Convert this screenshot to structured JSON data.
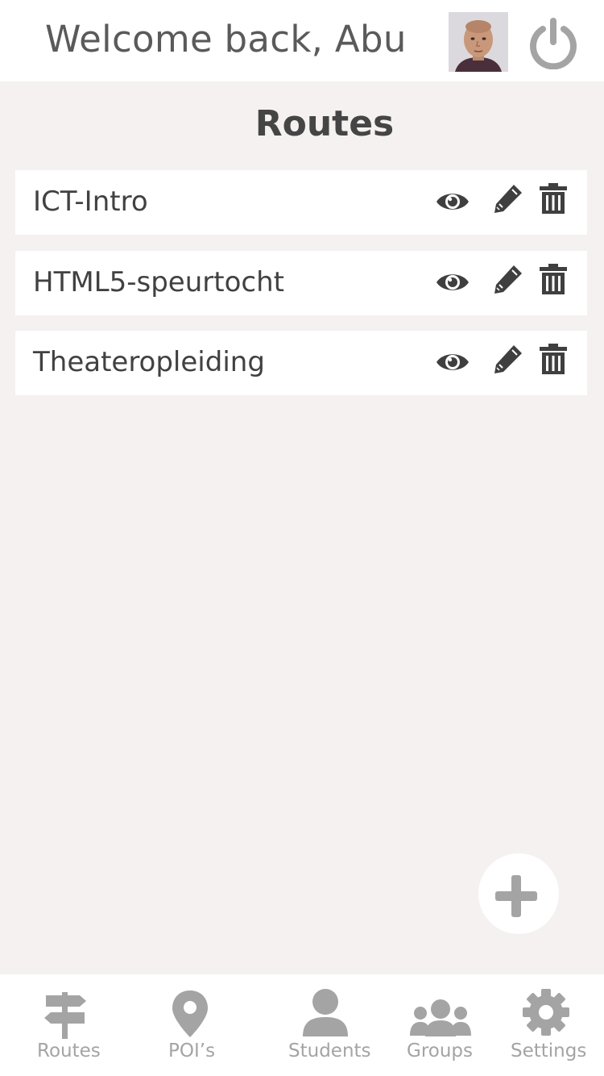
{
  "header": {
    "welcome_text": "Welcome back, Abu",
    "avatar_icon": "user-photo",
    "power_icon": "power-icon"
  },
  "main": {
    "title": "Routes",
    "routes": [
      {
        "name": "ICT-Intro"
      },
      {
        "name": "HTML5-speurtocht"
      },
      {
        "name": "Theateropleiding"
      }
    ],
    "row_actions": [
      "eye-icon",
      "pencil-icon",
      "trash-icon"
    ],
    "add_icon": "plus-icon"
  },
  "bottom_nav": {
    "items": [
      {
        "label": "Routes",
        "icon": "signpost-icon"
      },
      {
        "label": "POI’s",
        "icon": "map-pin-icon"
      },
      {
        "label": "Students",
        "icon": "person-icon"
      },
      {
        "label": "Groups",
        "icon": "group-icon"
      },
      {
        "label": "Settings",
        "icon": "gear-icon"
      }
    ]
  },
  "colors": {
    "background": "#f4f1f0",
    "surface": "#ffffff",
    "icon_dark": "#3f3f3f",
    "icon_muted": "#a4a4a4"
  }
}
